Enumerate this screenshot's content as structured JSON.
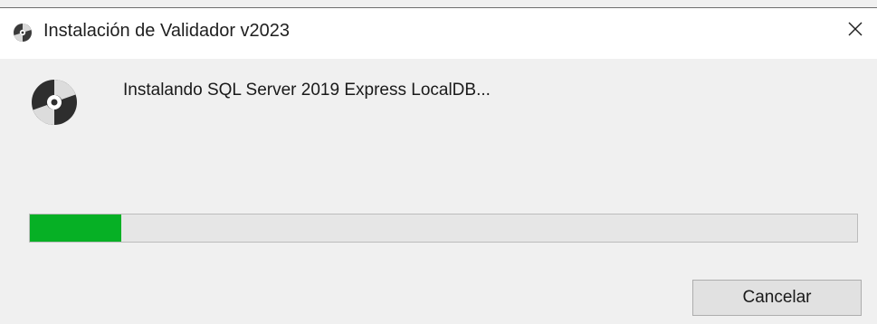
{
  "window": {
    "title": "Instalación de Validador v2023",
    "icon": "disc-installer-icon",
    "close_icon": "close-icon"
  },
  "main": {
    "icon": "disc-installer-icon",
    "status_text": "Instalando SQL Server 2019 Express LocalDB...",
    "progress_fraction": 0.11,
    "progress_color": "#06b025"
  },
  "buttons": {
    "cancel_label": "Cancelar"
  }
}
